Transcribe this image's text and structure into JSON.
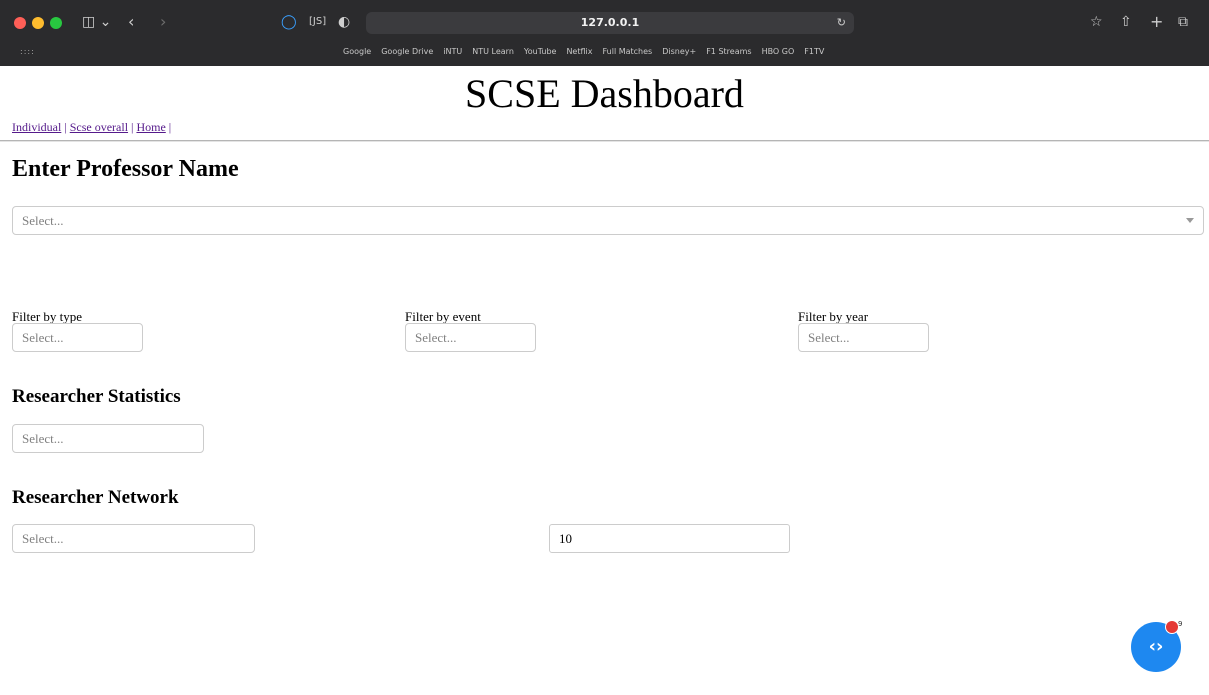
{
  "browser": {
    "url": "127.0.0.1",
    "bookmarks": [
      "Google",
      "Google Drive",
      "iNTU",
      "NTU Learn",
      "YouTube",
      "Netflix",
      "Full Matches",
      "Disney+",
      "F1 Streams",
      "HBO GO",
      "F1TV"
    ]
  },
  "page": {
    "title": "SCSE Dashboard",
    "nav": [
      {
        "label": "Individual"
      },
      {
        "label": "Scse overall"
      },
      {
        "label": "Home"
      }
    ],
    "nav_separator": " | "
  },
  "professor": {
    "heading": "Enter Professor Name",
    "placeholder": "Select..."
  },
  "filters": {
    "type": {
      "label": "Filter by type",
      "placeholder": "Select..."
    },
    "event": {
      "label": "Filter by event",
      "placeholder": "Select..."
    },
    "year": {
      "label": "Filter by year",
      "placeholder": "Select..."
    }
  },
  "statistics": {
    "heading": "Researcher Statistics",
    "placeholder": "Select..."
  },
  "network": {
    "heading": "Researcher Network",
    "placeholder": "Select...",
    "count_value": "10"
  },
  "fab": {
    "icon": "code-brackets-icon",
    "badge_count": "9",
    "color": "#1e88f0",
    "badge_color": "#e53935"
  }
}
